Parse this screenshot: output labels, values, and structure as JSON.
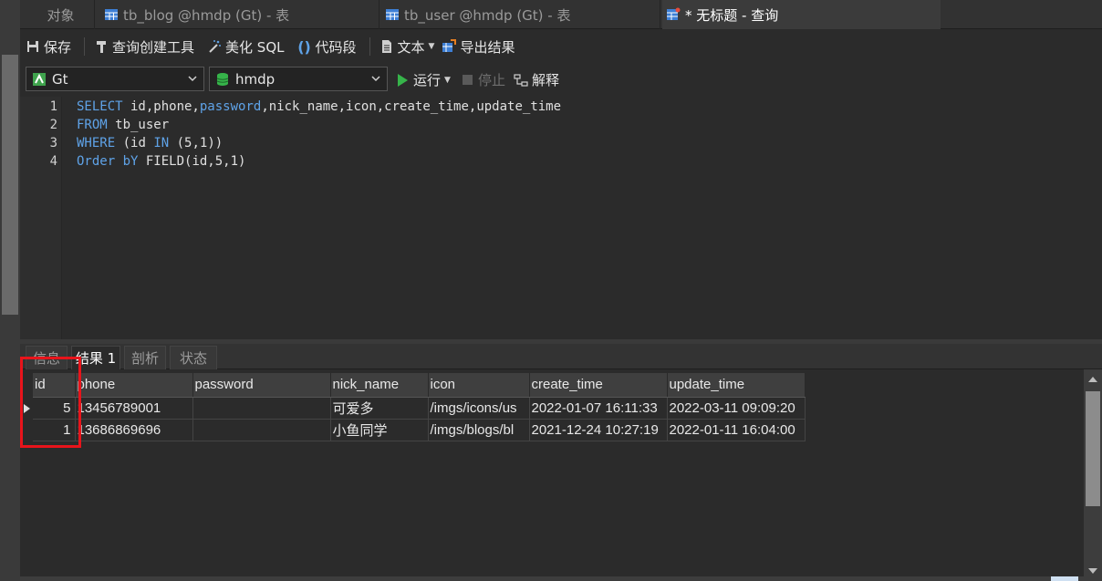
{
  "tabs": {
    "objects_label": "对象",
    "tab1_label": "tb_blog @hmdp (Gt) - 表",
    "tab2_label": "tb_user @hmdp (Gt) - 表",
    "active_label": "* 无标题 - 查询"
  },
  "toolbar": {
    "save": "保存",
    "query_builder": "查询创建工具",
    "beautify": "美化 SQL",
    "snippet": "代码段",
    "text": "文本",
    "export": "导出结果"
  },
  "selectors": {
    "connection": "Gt",
    "database": "hmdp",
    "run": "运行",
    "stop": "停止",
    "explain": "解释"
  },
  "editor": {
    "line_numbers": [
      "1",
      "2",
      "3",
      "4"
    ],
    "lines": {
      "l1_kw": "SELECT",
      "l1_rest": " id,phone,",
      "l1_kw2": "password",
      "l1_rest2": ",nick_name,icon,create_time,update_time",
      "l2_kw": "FROM",
      "l2_rest": " tb_user",
      "l3_kw": "WHERE",
      "l3_a": " (id ",
      "l3_kw2": "IN",
      "l3_b": " (5,1))",
      "l4_kw": "Order bY",
      "l4_rest": " FIELD(id,5,1)"
    }
  },
  "result_tabs": [
    "信息",
    "结果 1",
    "剖析",
    "状态"
  ],
  "grid": {
    "columns": [
      "id",
      "phone",
      "password",
      "nick_name",
      "icon",
      "create_time",
      "update_time"
    ],
    "rows": [
      [
        "5",
        "13456789001",
        "",
        "可爱多",
        "/imgs/icons/us",
        "2022-01-07 16:11:33",
        "2022-03-11 09:09:20"
      ],
      [
        "1",
        "13686869696",
        "",
        "小鱼同学",
        "/imgs/blogs/bl",
        "2021-12-24 10:27:19",
        "2022-01-11 16:04:00"
      ]
    ]
  },
  "colors": {
    "keyword": "#5fa3e8",
    "highlight": "#e8141b",
    "run_green": "#36b44a"
  }
}
